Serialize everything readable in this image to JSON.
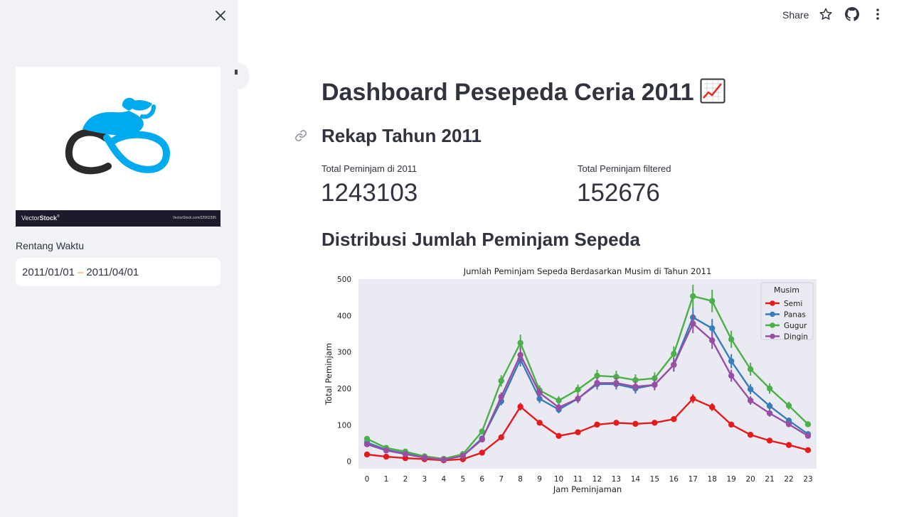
{
  "sidebar": {
    "logo": {
      "brand_light": "Vector",
      "brand_bold": "Stock",
      "brand_mark": "®",
      "url": "VectorStock.com/22962395"
    },
    "date_range": {
      "label": "Rentang Waktu",
      "start": "2011/01/01",
      "separator": "–",
      "end": "2011/04/01"
    }
  },
  "topbar": {
    "share_label": "Share"
  },
  "main": {
    "title": "Dashboard Pesepeda Ceria 2011",
    "recap_heading": "Rekap Tahun 2011",
    "metrics": [
      {
        "label": "Total Peminjam di 2011",
        "value": "1243103"
      },
      {
        "label": "Total Peminjam filtered",
        "value": "152676"
      }
    ],
    "distribution_heading": "Distribusi Jumlah Peminjam Sepeda"
  },
  "chart_data": {
    "type": "line",
    "title": "Jumlah Peminjam Sepeda Berdasarkan Musim di Tahun 2011",
    "xlabel": "Jam Peminjaman",
    "ylabel": "Total Peminjam",
    "x": [
      0,
      1,
      2,
      3,
      4,
      5,
      6,
      7,
      8,
      9,
      10,
      11,
      12,
      13,
      14,
      15,
      16,
      17,
      18,
      19,
      20,
      21,
      22,
      23
    ],
    "ylim": [
      -20,
      500
    ],
    "yticks": [
      0,
      100,
      200,
      300,
      400,
      500
    ],
    "grid": false,
    "legend": {
      "title": "Musim",
      "placement": "top-right"
    },
    "background": "#eaeaf2",
    "series": [
      {
        "name": "Semi",
        "color": "#e41a1c",
        "values": [
          19,
          13,
          9,
          6,
          3,
          6,
          24,
          66,
          150,
          106,
          70,
          80,
          101,
          106,
          103,
          106,
          116,
          172,
          149,
          101,
          73,
          57,
          45,
          31
        ]
      },
      {
        "name": "Panas",
        "color": "#377eb8",
        "values": [
          52,
          32,
          22,
          12,
          5,
          15,
          63,
          165,
          280,
          172,
          142,
          172,
          212,
          212,
          200,
          210,
          265,
          395,
          365,
          275,
          198,
          152,
          112,
          75
        ]
      },
      {
        "name": "Gugur",
        "color": "#4daf4a",
        "values": [
          62,
          37,
          27,
          14,
          7,
          20,
          82,
          221,
          325,
          195,
          167,
          197,
          235,
          232,
          223,
          228,
          295,
          453,
          440,
          335,
          253,
          200,
          153,
          102
        ]
      },
      {
        "name": "Dingin",
        "color": "#984ea3",
        "values": [
          47,
          30,
          20,
          10,
          5,
          15,
          60,
          177,
          292,
          188,
          148,
          172,
          215,
          215,
          205,
          210,
          265,
          378,
          332,
          235,
          167,
          132,
          102,
          70
        ]
      }
    ]
  }
}
